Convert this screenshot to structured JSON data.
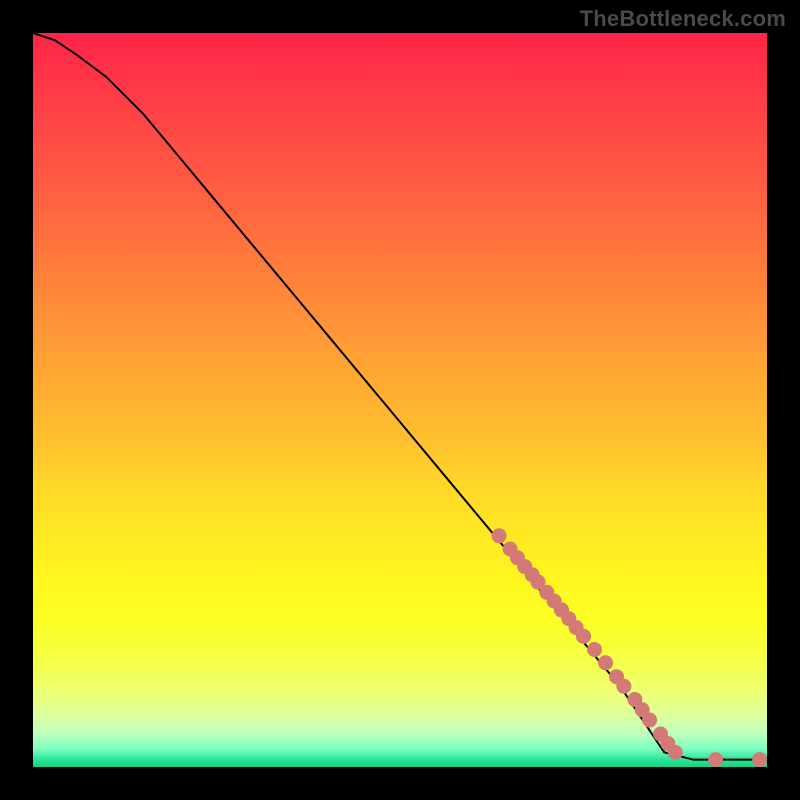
{
  "watermark": "TheBottleneck.com",
  "chart_data": {
    "type": "line",
    "title": "",
    "xlabel": "",
    "ylabel": "",
    "xlim": [
      0,
      100
    ],
    "ylim": [
      0,
      100
    ],
    "grid": false,
    "legend": false,
    "series": [
      {
        "name": "curve",
        "style": "line",
        "color": "#000000",
        "x": [
          0,
          3,
          6,
          10,
          15,
          20,
          25,
          30,
          35,
          40,
          45,
          50,
          55,
          60,
          65,
          70,
          75,
          80,
          84,
          86,
          90,
          95,
          100
        ],
        "values": [
          100,
          99,
          97,
          94,
          89,
          83,
          77,
          71,
          65,
          59,
          53,
          47,
          41,
          35,
          29,
          23,
          17,
          11,
          5,
          2,
          1,
          1,
          1
        ]
      },
      {
        "name": "marker-cluster",
        "style": "scatter",
        "color": "#d47a76",
        "x": [
          63.5,
          65.0,
          66.0,
          67.0,
          68.0,
          68.8,
          70.0,
          71.0,
          72.0,
          73.0,
          74.0,
          75.0,
          76.5,
          78.0,
          79.5,
          80.5,
          82.0,
          83.0,
          84.0,
          85.5,
          86.5,
          87.5,
          93.0,
          99.0
        ],
        "values": [
          31.5,
          29.7,
          28.5,
          27.3,
          26.2,
          25.2,
          23.8,
          22.6,
          21.4,
          20.2,
          19.0,
          17.8,
          16.0,
          14.2,
          12.3,
          11.0,
          9.2,
          7.8,
          6.4,
          4.5,
          3.2,
          2.0,
          1.0,
          1.0
        ]
      }
    ]
  }
}
